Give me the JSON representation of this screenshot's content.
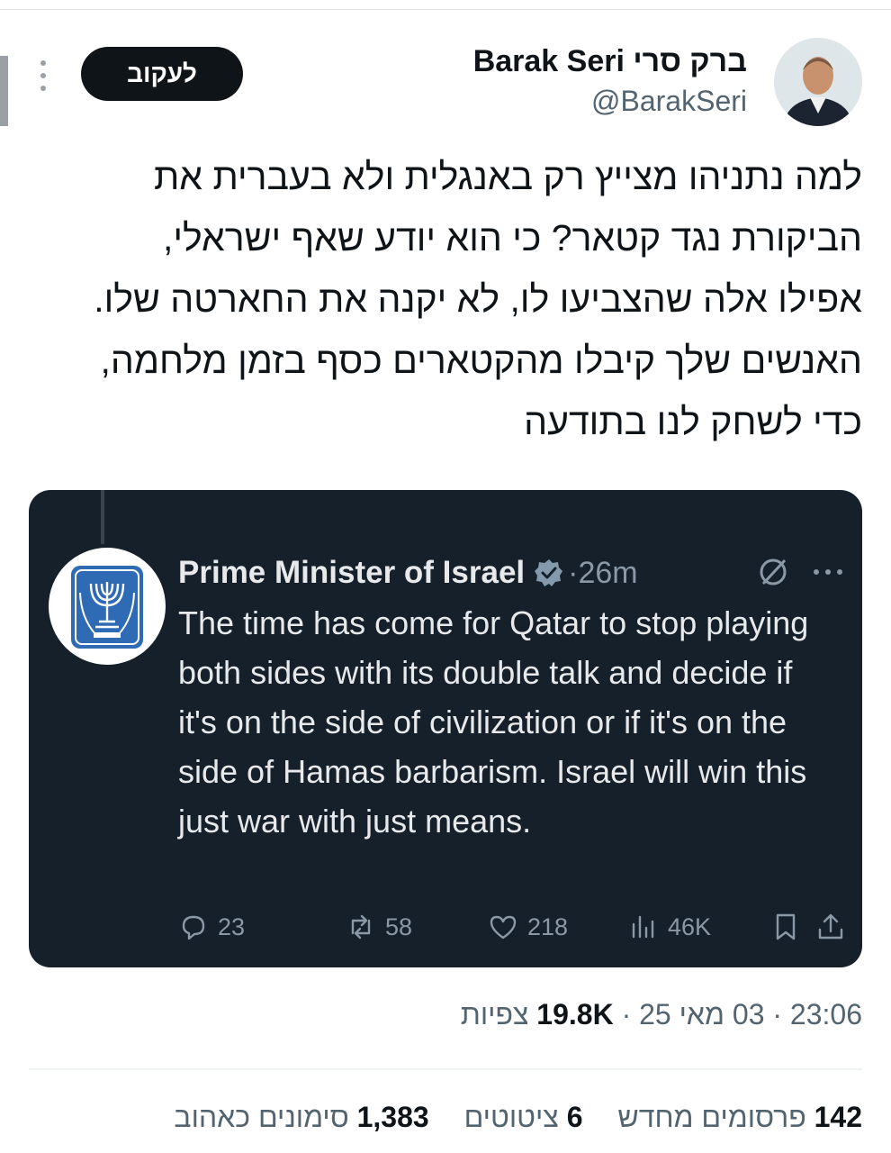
{
  "header": {
    "display_name": "Barak Seri ברק סרי",
    "handle": "@BarakSeri",
    "follow_label": "לעקוב"
  },
  "post": {
    "text": "למה נתניהו מצייץ רק באנגלית ולא בעברית את הביקורת נגד קטאר? כי הוא יודע שאף ישראלי, אפילו אלה שהצביעו לו, לא יקנה את החארטה שלו. האנשים שלך קיבלו מהקטארים כסף בזמן מלחמה, כדי לשחק לנו בתודעה"
  },
  "quoted": {
    "name": "Prime Minister of Israel",
    "time": "·26m",
    "text": "The time has come for Qatar to stop playing both sides with its double talk and decide if it's on the side of civilization or if it's on the side of Hamas barbarism. Israel will win this just war with just means.",
    "replies": "23",
    "reposts": "58",
    "likes": "218",
    "views": "46K"
  },
  "meta": {
    "time": "23:06",
    "sep": "·",
    "date": "03 מאי 25",
    "views_count": "19.8K",
    "views_label": "צפיות"
  },
  "stats": {
    "reposts_count": "142",
    "reposts_label": "פרסומים מחדש",
    "quotes_count": "6",
    "quotes_label": "ציטוטים",
    "likes_count": "1,383",
    "likes_label": "סימונים כאהוב"
  },
  "colors": {
    "follow_bg": "#0f1419",
    "quote_bg": "#15202b",
    "muted": "#536471",
    "quote_muted": "#8b98a5"
  }
}
